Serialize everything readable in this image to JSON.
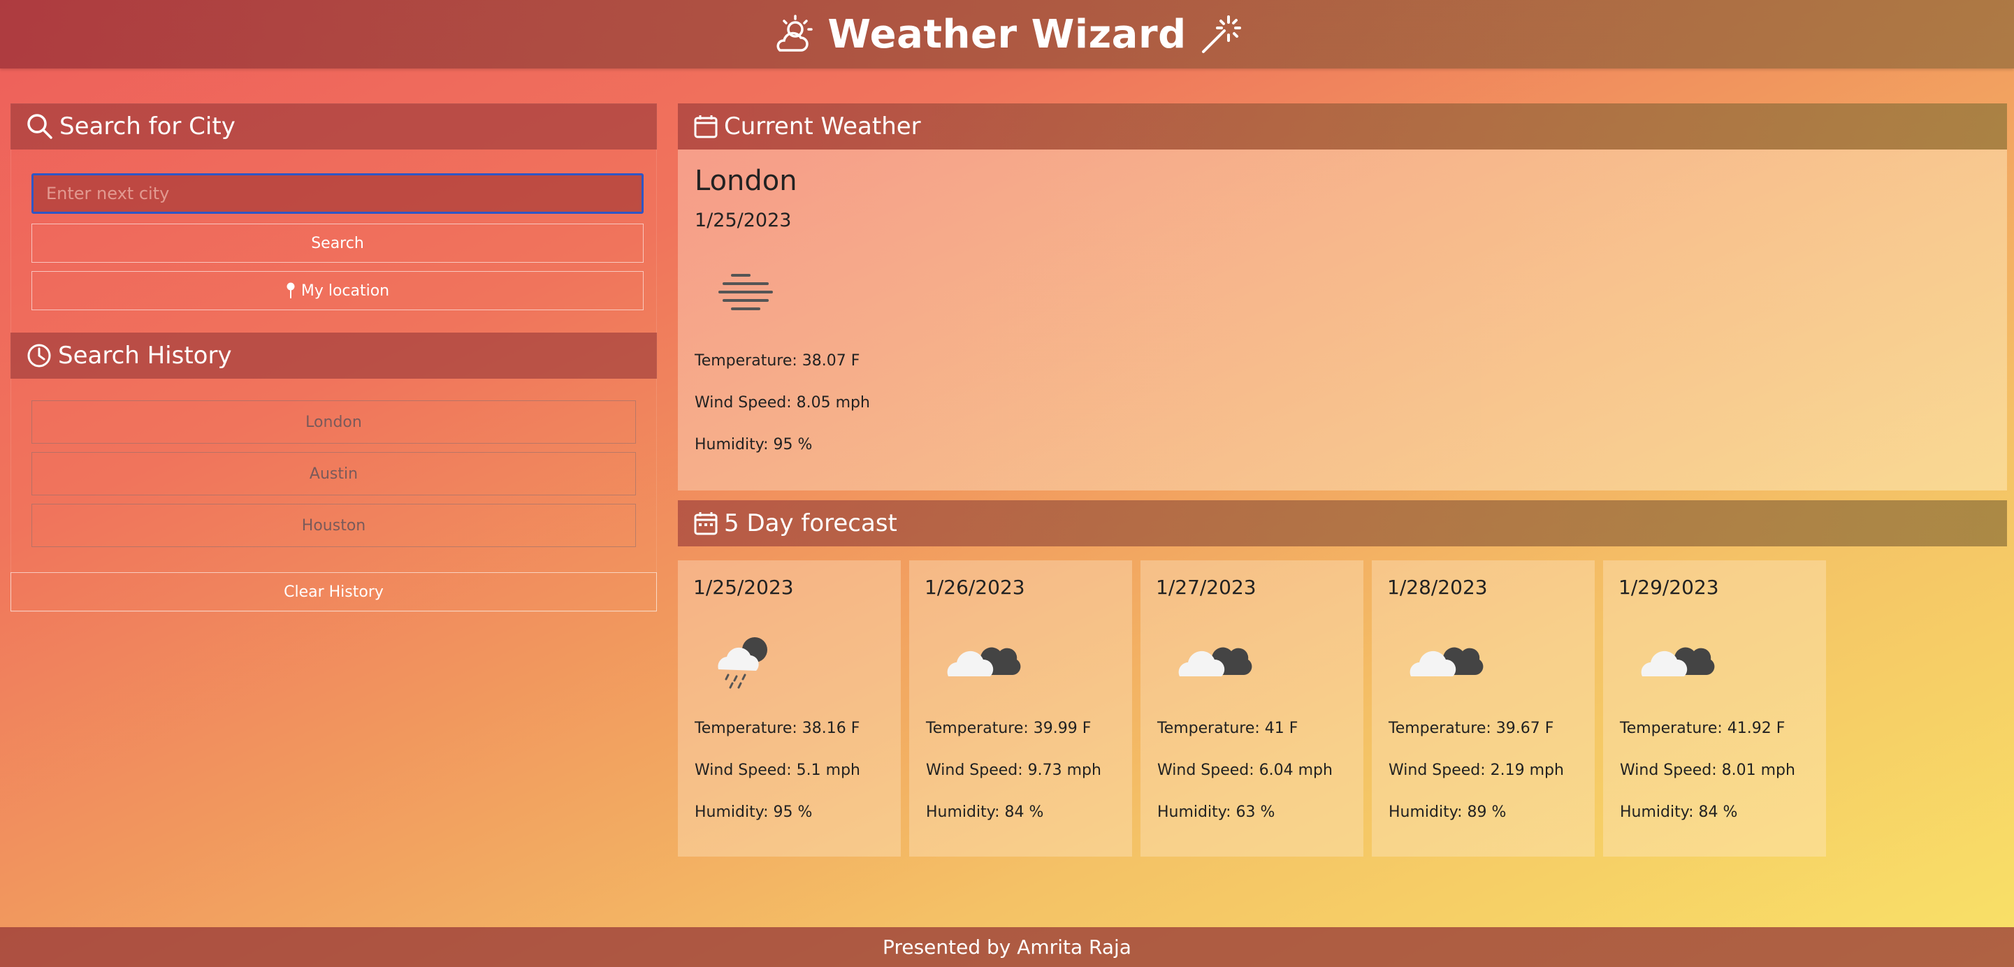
{
  "header": {
    "title": "Weather Wizard",
    "left_icon": "sun-cloud-icon",
    "right_icon": "magic-wand-icon"
  },
  "search": {
    "heading": "Search for City",
    "placeholder": "Enter next city",
    "value": "",
    "search_button": "Search",
    "location_button": "My location"
  },
  "history": {
    "heading": "Search History",
    "items": [
      "London",
      "Austin",
      "Houston"
    ],
    "clear_button": "Clear History"
  },
  "current": {
    "heading": "Current Weather",
    "city": "London",
    "date": "1/25/2023",
    "icon": "fog-icon",
    "temperature": "Temperature: 38.07 F",
    "wind": "Wind Speed: 8.05 mph",
    "humidity": "Humidity: 95 %"
  },
  "forecast": {
    "heading": "5 Day forecast",
    "days": [
      {
        "date": "1/25/2023",
        "icon": "rain-cloud-icon",
        "temperature": "Temperature: 38.16 F",
        "wind": "Wind Speed: 5.1 mph",
        "humidity": "Humidity: 95 %"
      },
      {
        "date": "1/26/2023",
        "icon": "cloudy-icon",
        "temperature": "Temperature: 39.99 F",
        "wind": "Wind Speed: 9.73 mph",
        "humidity": "Humidity: 84 %"
      },
      {
        "date": "1/27/2023",
        "icon": "cloudy-icon",
        "temperature": "Temperature: 41 F",
        "wind": "Wind Speed: 6.04 mph",
        "humidity": "Humidity: 63 %"
      },
      {
        "date": "1/28/2023",
        "icon": "cloudy-icon",
        "temperature": "Temperature: 39.67 F",
        "wind": "Wind Speed: 2.19 mph",
        "humidity": "Humidity: 89 %"
      },
      {
        "date": "1/29/2023",
        "icon": "cloudy-icon",
        "temperature": "Temperature: 41.92 F",
        "wind": "Wind Speed: 8.01 mph",
        "humidity": "Humidity: 84 %"
      }
    ]
  },
  "footer": {
    "text": "Presented by Amrita Raja"
  }
}
